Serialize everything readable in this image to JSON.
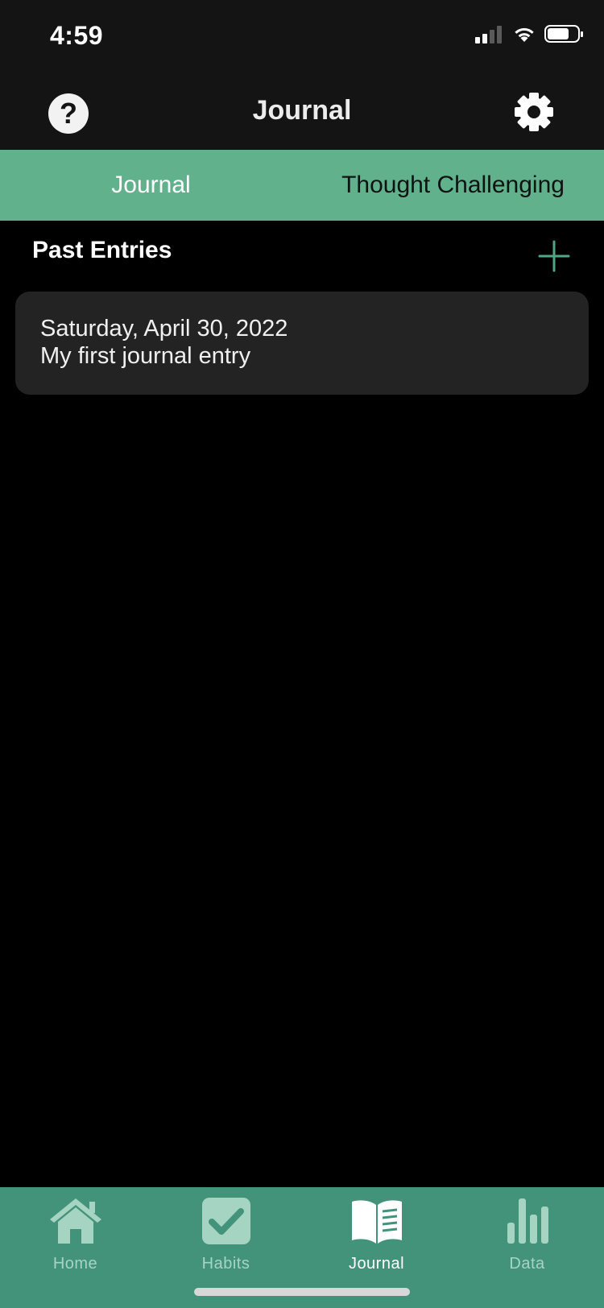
{
  "status_bar": {
    "time": "4:59"
  },
  "header": {
    "title": "Journal",
    "help_icon": "question-circle-icon",
    "settings_icon": "gear-icon"
  },
  "tabs": [
    {
      "label": "Journal",
      "active": true
    },
    {
      "label": "Thought Challenging",
      "active": false
    }
  ],
  "section": {
    "title": "Past Entries",
    "add_icon": "plus-icon"
  },
  "entries": [
    {
      "date": "Saturday, April 30, 2022",
      "title": "My first journal entry"
    }
  ],
  "bottom_tabs": [
    {
      "label": "Home",
      "icon": "house-icon",
      "active": false
    },
    {
      "label": "Habits",
      "icon": "checkbox-icon",
      "active": false
    },
    {
      "label": "Journal",
      "icon": "open-book-icon",
      "active": true
    },
    {
      "label": "Data",
      "icon": "bar-chart-icon",
      "active": false
    }
  ],
  "colors": {
    "header_bg": "#141414",
    "tab_bar_bg": "#62b18d",
    "bottom_bar_bg": "#43937a",
    "card_bg": "#232323",
    "accent": "#4fa783",
    "inactive_icon": "#a6d4c3"
  }
}
